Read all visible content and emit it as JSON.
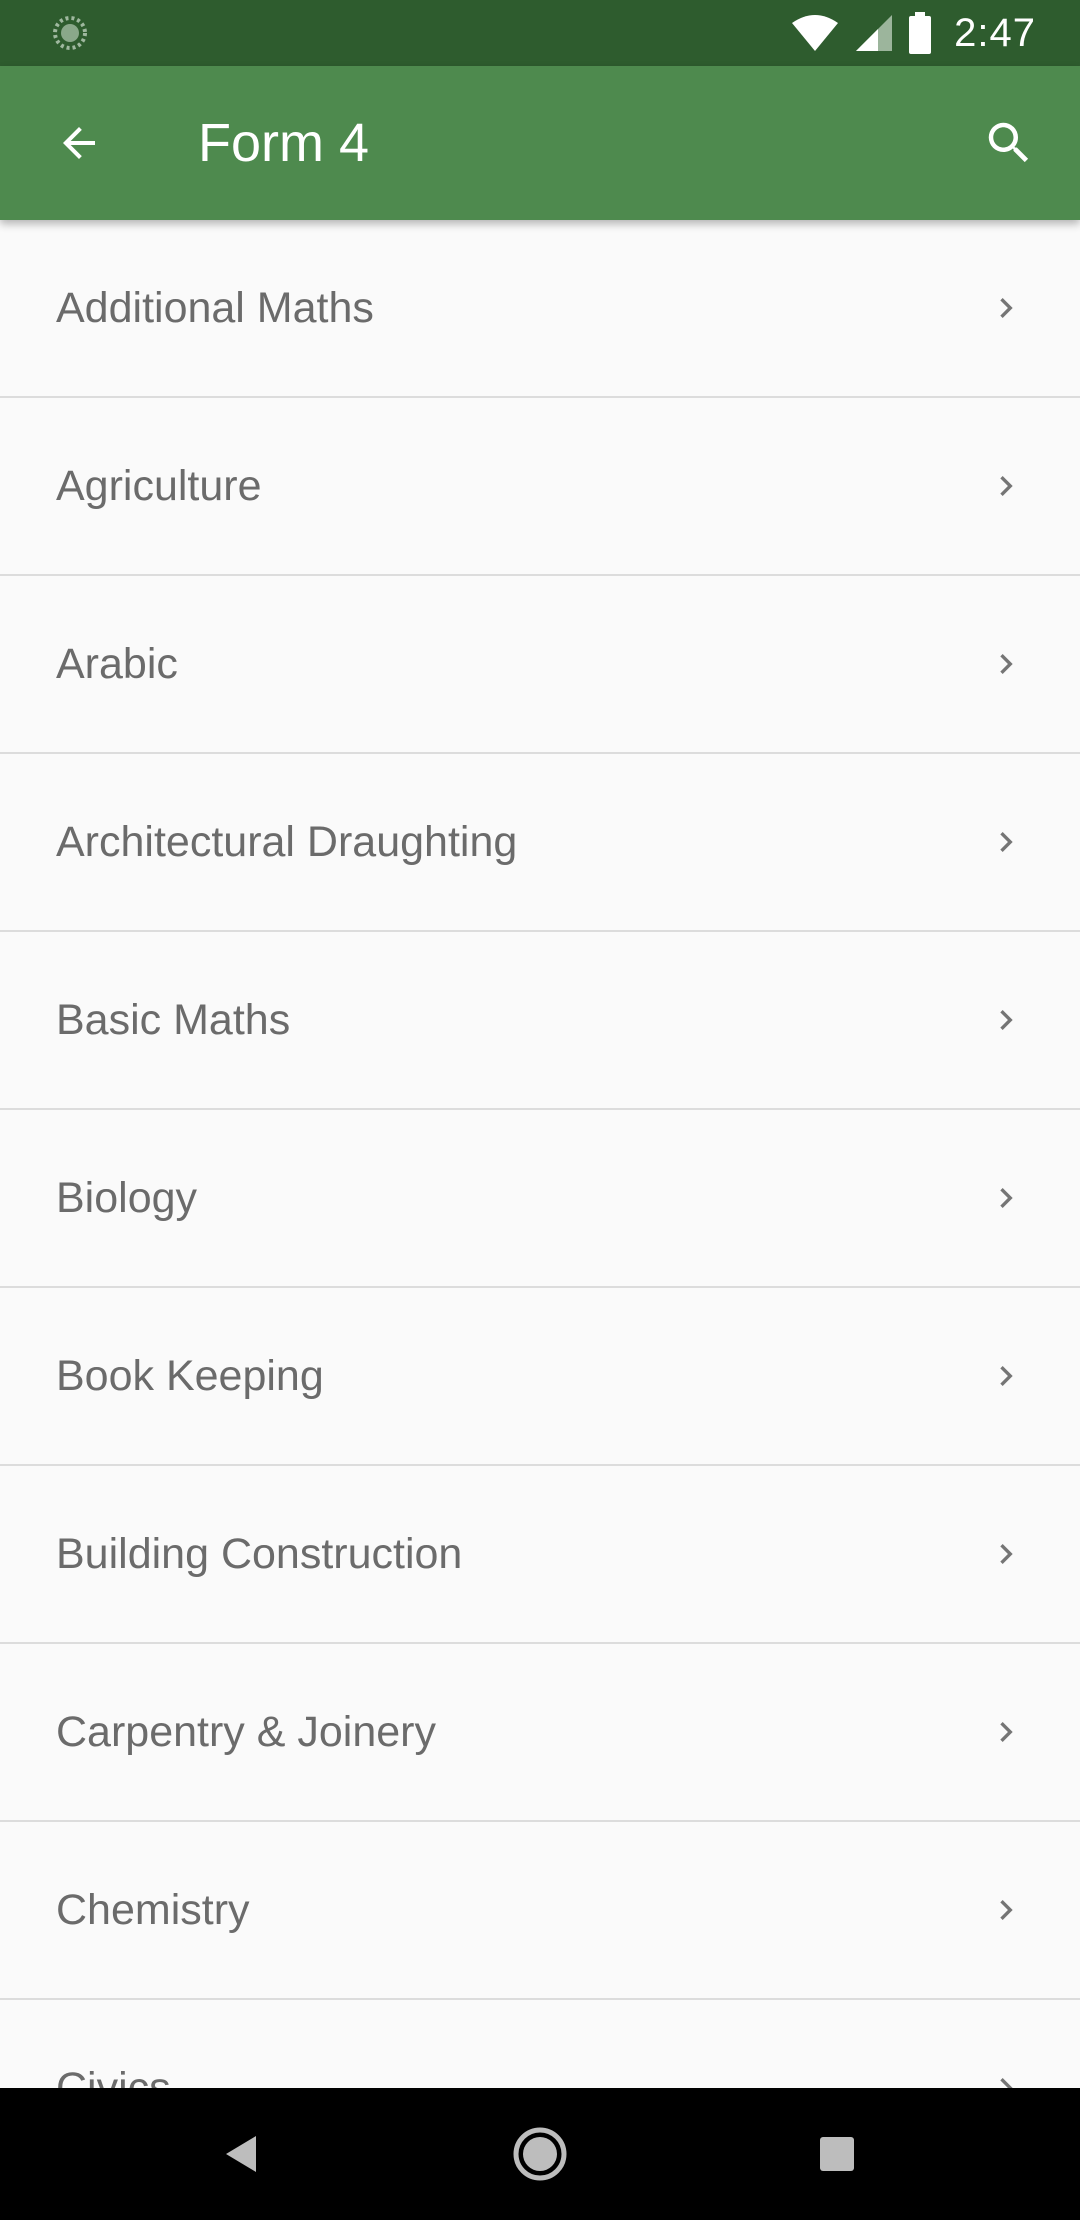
{
  "status_bar": {
    "time": "2:47",
    "icons": [
      "loading-icon",
      "wifi-icon",
      "signal-icon",
      "battery-icon"
    ]
  },
  "app_bar": {
    "title": "Form 4",
    "back_icon": "arrow-back-icon",
    "search_icon": "search-icon",
    "color": "#4e8a4e",
    "status_color": "#2e5c2e"
  },
  "subjects": [
    "Additional Maths",
    "Agriculture",
    "Arabic",
    "Architectural Draughting",
    "Basic Maths",
    "Biology",
    "Book Keeping",
    "Building Construction",
    "Carpentry & Joinery",
    "Chemistry",
    "Civics"
  ],
  "nav_bar": {
    "icons": [
      "nav-back-icon",
      "nav-home-icon",
      "nav-recents-icon"
    ]
  }
}
